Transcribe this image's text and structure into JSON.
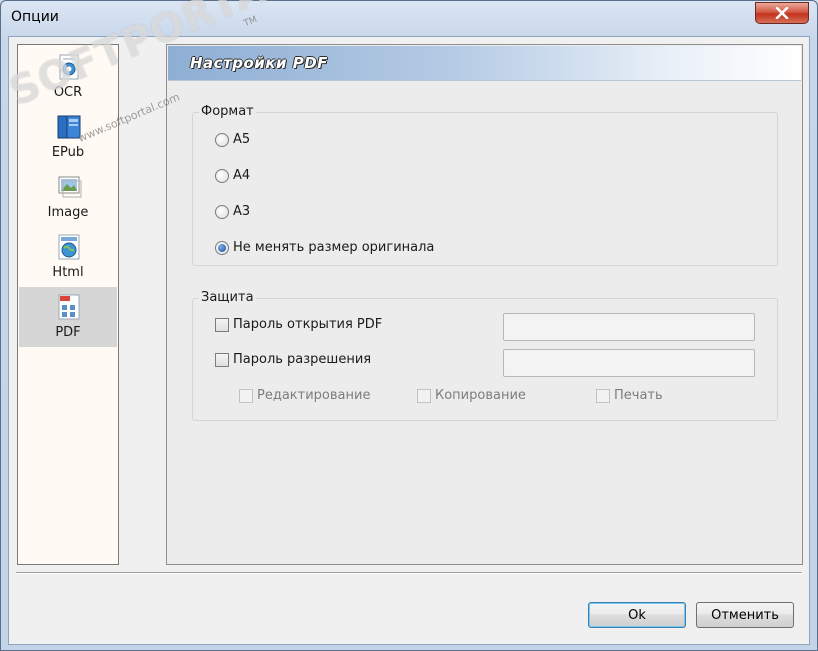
{
  "window": {
    "title": "Опции"
  },
  "sidebar": {
    "items": [
      {
        "label": "OCR",
        "icon": "ocr-icon"
      },
      {
        "label": "EPub",
        "icon": "epub-icon"
      },
      {
        "label": "Image",
        "icon": "image-icon"
      },
      {
        "label": "Html",
        "icon": "html-icon"
      },
      {
        "label": "PDF",
        "icon": "pdf-icon",
        "selected": true
      }
    ]
  },
  "panel": {
    "title": "Настройки PDF",
    "format": {
      "legend": "Формат",
      "options": [
        {
          "label": "A5",
          "checked": false
        },
        {
          "label": "A4",
          "checked": false
        },
        {
          "label": "A3",
          "checked": false
        },
        {
          "label": "Не менять размер оригинала",
          "checked": true
        }
      ]
    },
    "protection": {
      "legend": "Защита",
      "open_password": {
        "label": "Пароль открытия PDF",
        "checked": false,
        "value": ""
      },
      "permission_password": {
        "label": "Пароль разрешения",
        "checked": false,
        "value": ""
      },
      "permissions": [
        {
          "label": "Редактирование",
          "checked": false,
          "enabled": false
        },
        {
          "label": "Копирование",
          "checked": false,
          "enabled": false
        },
        {
          "label": "Печать",
          "checked": false,
          "enabled": false
        }
      ]
    }
  },
  "buttons": {
    "ok": "Ok",
    "cancel": "Отменить"
  },
  "watermark": {
    "brand": "SOFTPORTAL",
    "site": "www.softportal.com",
    "tm": "TM"
  },
  "colors": {
    "header_gradient_start": "#8eaed3",
    "selected_item": "#d6d6d6",
    "close_button": "#c2321c"
  }
}
